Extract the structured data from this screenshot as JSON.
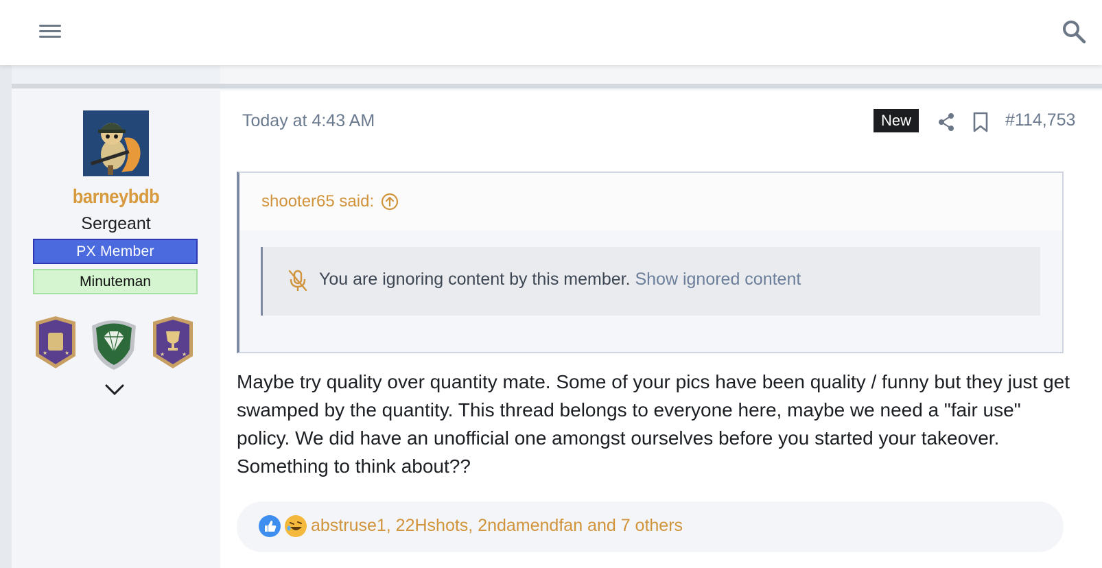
{
  "header": {
    "menu_icon": "hamburger-menu-icon",
    "search_icon": "search-icon"
  },
  "user": {
    "username": "barneybdb",
    "rank": "Sergeant",
    "banners": [
      "PX Member",
      "Minuteman"
    ],
    "trophies": [
      "shield-trophy-icon",
      "diamond-trophy-icon",
      "cup-trophy-icon"
    ],
    "expand_icon": "chevron-down-icon"
  },
  "post": {
    "timestamp": "Today at 4:43 AM",
    "new_badge": "New",
    "post_number": "#114,753",
    "quote": {
      "author_said": "shooter65 said:",
      "ignored_text": "You are ignoring content by this member.",
      "ignored_link": "Show ignored content"
    },
    "body": "Maybe try quality over quantity mate. Some of your pics have been quality / funny but they just get swamped by the quantity. This thread belongs to everyone here, maybe we need a \"fair use\" policy. We did have an unofficial one amongst ourselves before you started your takeover. Something to think about??",
    "reactions": {
      "icons": [
        "like-icon",
        "laugh-icon"
      ],
      "users_text": "abstruse1, 22Hshots, 2ndamendfan and 7 others"
    }
  },
  "colors": {
    "accent_orange": "#d1943c",
    "px_banner": "#4a6ade",
    "minuteman_banner": "#d4f5cf"
  }
}
